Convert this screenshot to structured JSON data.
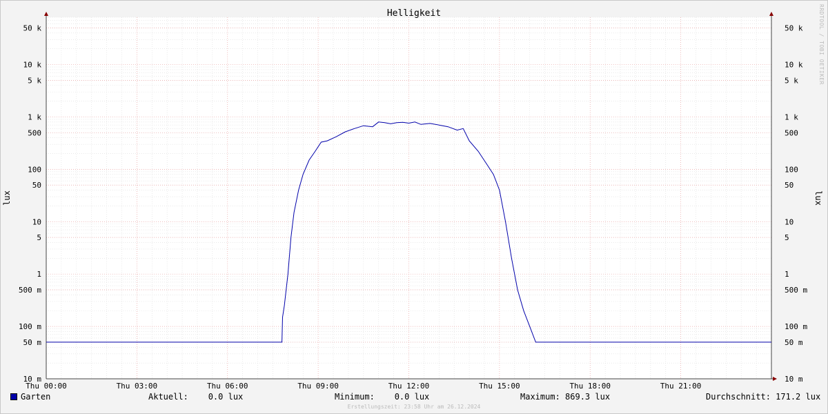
{
  "chart_data": {
    "type": "line",
    "title": "Helligkeit",
    "ylabel": "lux",
    "y_scale": "log",
    "ylim": [
      0.01,
      80000
    ],
    "xlim": [
      "Thu 00:00",
      "Thu 24:00"
    ],
    "y_ticks": [
      {
        "value": 50000,
        "label": "50 k"
      },
      {
        "value": 10000,
        "label": "10 k"
      },
      {
        "value": 5000,
        "label": "5 k"
      },
      {
        "value": 1000,
        "label": "1 k"
      },
      {
        "value": 500,
        "label": "500"
      },
      {
        "value": 100,
        "label": "100"
      },
      {
        "value": 50,
        "label": "50"
      },
      {
        "value": 10,
        "label": "10"
      },
      {
        "value": 5,
        "label": "5"
      },
      {
        "value": 1,
        "label": "1"
      },
      {
        "value": 0.5,
        "label": "500 m"
      },
      {
        "value": 0.1,
        "label": "100 m"
      },
      {
        "value": 0.05,
        "label": "50 m"
      },
      {
        "value": 0.01,
        "label": "10 m"
      }
    ],
    "x_ticks": [
      "Thu 00:00",
      "Thu 03:00",
      "Thu 06:00",
      "Thu 09:00",
      "Thu 12:00",
      "Thu 15:00",
      "Thu 18:00",
      "Thu 21:00"
    ],
    "grid": true,
    "series": [
      {
        "name": "Garten",
        "color": "#0000aa",
        "x_hours": [
          0,
          7.8,
          7.82,
          7.88,
          8.0,
          8.1,
          8.2,
          8.35,
          8.5,
          8.7,
          8.9,
          9.1,
          9.3,
          9.6,
          9.9,
          10.2,
          10.5,
          10.8,
          11.0,
          11.2,
          11.4,
          11.6,
          11.8,
          12.0,
          12.2,
          12.4,
          12.7,
          13.0,
          13.3,
          13.6,
          13.8,
          14.0,
          14.3,
          14.6,
          14.8,
          15.0,
          15.2,
          15.4,
          15.6,
          15.8,
          16.0,
          16.2,
          16.4,
          16.6,
          16.8,
          16.9,
          17.0,
          17.05,
          17.1,
          17.2,
          17.35,
          17.55,
          17.56,
          17.65,
          17.66,
          18.5,
          18.51,
          18.6,
          18.61,
          18.72,
          18.73,
          18.85,
          18.86,
          19.8,
          19.81,
          19.92,
          19.93,
          20.02,
          20.03,
          20.9,
          20.91,
          21.02,
          21.03,
          22.08,
          22.09,
          22.2,
          22.21,
          22.45,
          22.46,
          22.8,
          22.81,
          22.84,
          22.85,
          23.2,
          23.21,
          23.3,
          23.31,
          24
        ],
        "y_lux": [
          0.05,
          0.05,
          0.15,
          0.25,
          1.0,
          5.0,
          15,
          40,
          80,
          150,
          220,
          330,
          350,
          420,
          520,
          600,
          680,
          650,
          800,
          780,
          740,
          780,
          790,
          760,
          800,
          720,
          750,
          700,
          650,
          560,
          600,
          350,
          220,
          120,
          80,
          40,
          10,
          2,
          0.5,
          0.2,
          0.1,
          0.05,
          0.05,
          0.05,
          0.05,
          0.05,
          0.05,
          0.05,
          0.05,
          0.05,
          0.05,
          0.05,
          0.05,
          0.05,
          0.05,
          0.05,
          0.05,
          0.05,
          0.05,
          0.05,
          0.05,
          0.05,
          0.05,
          0.05,
          0.05,
          0.05,
          0.05,
          0.05,
          0.05,
          0.05,
          0.05,
          0.05,
          0.05,
          0.05,
          0.05,
          0.05,
          0.05,
          0.05,
          0.05,
          0.05,
          0.05,
          0.05,
          0.05,
          0.05,
          0.05,
          0.05,
          0.05,
          0.05
        ]
      }
    ],
    "legend": {
      "series_name": "Garten",
      "current": "Aktuell:    0.0 lux",
      "minimum": "Minimum:    0.0 lux",
      "maximum": "Maximum: 869.3 lux",
      "average": "Durchschnitt: 171.2 lux"
    }
  },
  "footer": "Erstellungszeit: 23:58 Uhr am 26.12.2024",
  "credit": "RRDTOOL / TOBI OETIKER"
}
